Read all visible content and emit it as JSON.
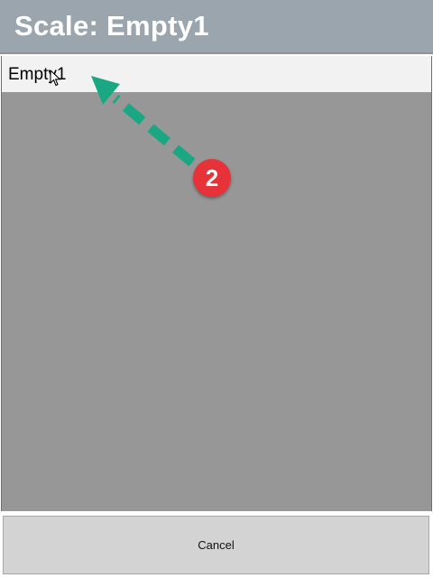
{
  "header": {
    "title": "Scale: Empty1"
  },
  "list": {
    "items": [
      {
        "label": "Empty1"
      }
    ]
  },
  "annotation": {
    "step_number": "2",
    "arrow_color": "#1aa882",
    "badge_color": "#e8323a"
  },
  "footer": {
    "cancel_label": "Cancel"
  },
  "colors": {
    "header_bg": "#9aa5ae",
    "list_bg": "#979797",
    "item_bg": "#f2f2f2",
    "button_bg": "#d3d3d3"
  }
}
